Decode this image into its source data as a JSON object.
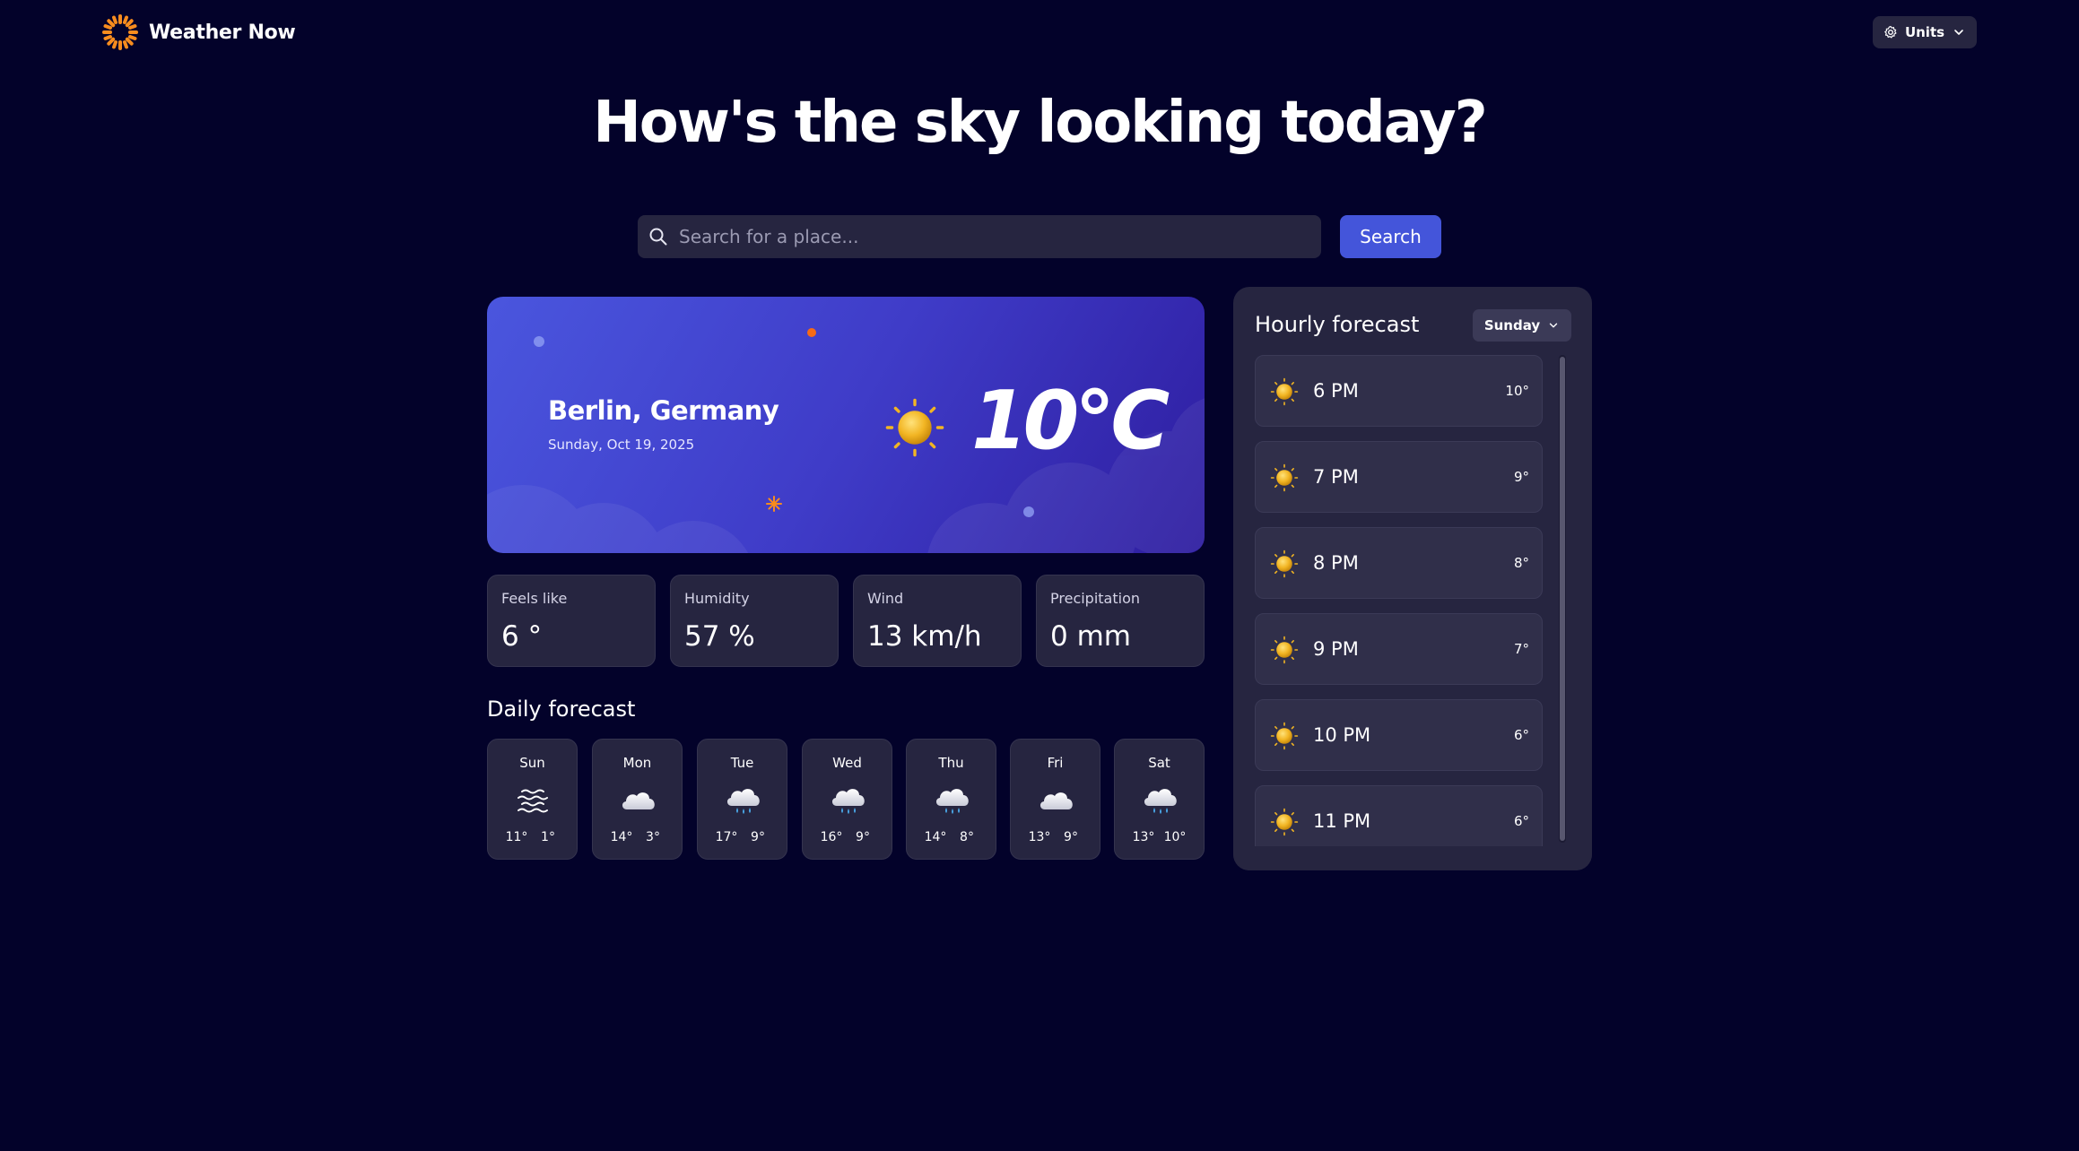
{
  "header": {
    "app_name": "Weather Now",
    "units_label": "Units"
  },
  "headline": "How's the sky looking today?",
  "search": {
    "placeholder": "Search for a place...",
    "value": "",
    "button_label": "Search"
  },
  "current": {
    "location": "Berlin, Germany",
    "date": "Sunday, Oct 19, 2025",
    "temperature": "10°C",
    "condition_icon": "sunny-icon"
  },
  "stats": [
    {
      "label": "Feels like",
      "value": "6 °"
    },
    {
      "label": "Humidity",
      "value": "57 %"
    },
    {
      "label": "Wind",
      "value": "13 km/h"
    },
    {
      "label": "Precipitation",
      "value": "0 mm"
    }
  ],
  "daily": {
    "title": "Daily forecast",
    "days": [
      {
        "day": "Sun",
        "icon": "fog-icon",
        "high": "11°",
        "low": "1°"
      },
      {
        "day": "Mon",
        "icon": "cloud-icon",
        "high": "14°",
        "low": "3°"
      },
      {
        "day": "Tue",
        "icon": "rain-icon",
        "high": "17°",
        "low": "9°"
      },
      {
        "day": "Wed",
        "icon": "rain-icon",
        "high": "16°",
        "low": "9°"
      },
      {
        "day": "Thu",
        "icon": "rain-icon",
        "high": "14°",
        "low": "8°"
      },
      {
        "day": "Fri",
        "icon": "cloud-icon",
        "high": "13°",
        "low": "9°"
      },
      {
        "day": "Sat",
        "icon": "rain-icon",
        "high": "13°",
        "low": "10°"
      }
    ]
  },
  "hourly": {
    "title": "Hourly forecast",
    "selected_day": "Sunday",
    "hours": [
      {
        "time": "6 PM",
        "temp": "10°",
        "icon": "sunny-icon"
      },
      {
        "time": "7 PM",
        "temp": "9°",
        "icon": "sunny-icon"
      },
      {
        "time": "8 PM",
        "temp": "8°",
        "icon": "sunny-icon"
      },
      {
        "time": "9 PM",
        "temp": "7°",
        "icon": "sunny-icon"
      },
      {
        "time": "10 PM",
        "temp": "6°",
        "icon": "sunny-icon"
      },
      {
        "time": "11 PM",
        "temp": "6°",
        "icon": "sunny-icon"
      }
    ]
  },
  "colors": {
    "background": "#03022a",
    "card": "#262540",
    "accent": "#4455da",
    "logo": "#f78c1e"
  }
}
